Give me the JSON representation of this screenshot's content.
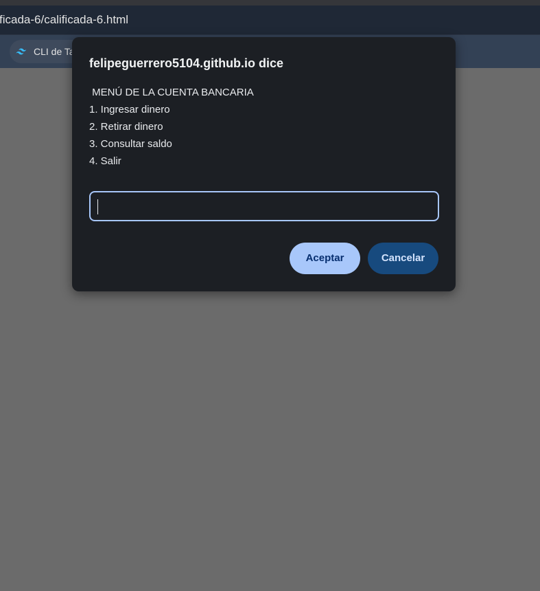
{
  "browser": {
    "address_text": "ficada-6/calificada-6.html",
    "bookmark_label": "CLI de Ta",
    "bookmark_icon": "tailwind-logo-icon"
  },
  "dialog": {
    "title": "felipeguerrero5104.github.io dice",
    "message_lines": [
      " MENÚ DE LA CUENTA BANCARIA",
      "1. Ingresar dinero",
      "2. Retirar dinero",
      "3. Consultar saldo",
      "4. Salir"
    ],
    "input_value": "",
    "accept_label": "Aceptar",
    "cancel_label": "Cancelar"
  },
  "colors": {
    "dialog_bg": "#1c1f24",
    "accent": "#a8c7fa",
    "cancel_bg": "#174a7e",
    "page_bg": "#6b6b6b"
  }
}
